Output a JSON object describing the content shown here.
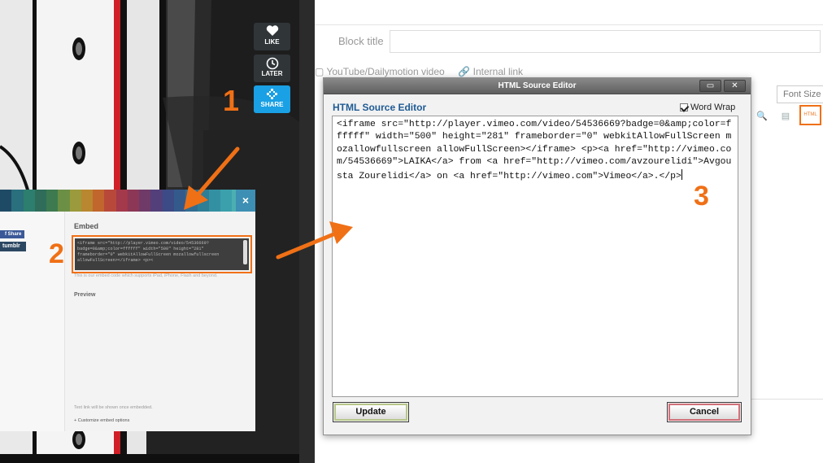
{
  "player": {
    "like_label": "LIKE",
    "later_label": "LATER",
    "share_label": "SHARE"
  },
  "callouts": {
    "one": "1",
    "two": "2",
    "three": "3"
  },
  "share_panel": {
    "fb_label": "f Share",
    "tumblr_label": "tumblr",
    "close_glyph": "×",
    "embed_title": "Embed",
    "embed_code": "<iframe src=\"http://player.vimeo.com/video/54536669?badge=0&amp;color=ffffff\" width=\"500\" height=\"281\" frameborder=\"0\" webkitAllowFullScreen mozallowfullscreen allowFullScreen></iframe> <p><",
    "embed_note": "This is our embed code which supports iPad, iPhone, Flash and beyond.",
    "preview_label": "Preview",
    "textlink_note": "Text link will be shown once embedded.",
    "customize_label": "+ Customize embed options",
    "swatch_colors": [
      "#1f4a66",
      "#2a6f7d",
      "#2d7e6e",
      "#2f6d5a",
      "#3d7a4f",
      "#6c8f46",
      "#9b9a3c",
      "#b9872f",
      "#c1662d",
      "#b8483a",
      "#a3394b",
      "#8c3756",
      "#6f3a68",
      "#53407a",
      "#3c4a86",
      "#345a8c",
      "#316d93",
      "#2e7e96",
      "#3390a2",
      "#3ba0ab",
      "#4bafb1",
      "#5cb5ad"
    ]
  },
  "editor": {
    "block_title_label": "Block title",
    "block_title_value": "",
    "option_video": "YouTube/Dailymotion video",
    "option_internal": "Internal link",
    "font_size_label": "Font Size",
    "html_button_label": "HTML"
  },
  "modal": {
    "title": "HTML Source Editor",
    "heading": "HTML Source Editor",
    "word_wrap_label": "Word Wrap",
    "word_wrap_checked": true,
    "source": "<iframe src=\"http://player.vimeo.com/video/54536669?badge=0&amp;color=ffffff\" width=\"500\" height=\"281\" frameborder=\"0\" webkitAllowFullScreen mozallowfullscreen allowFullScreen></iframe> <p><a href=\"http://vimeo.com/54536669\">LAIKA</a> from <a href=\"http://vimeo.com/avzourelidi\">Avgousta Zourelidi</a> on <a href=\"http://vimeo.com\">Vimeo</a>.</p>",
    "update_label": "Update",
    "cancel_label": "Cancel",
    "maximize_glyph": "▭",
    "close_glyph": "✕"
  },
  "colors": {
    "accent_orange": "#f07016",
    "share_blue": "#1aa0e4",
    "heading_blue": "#1f5b94"
  }
}
